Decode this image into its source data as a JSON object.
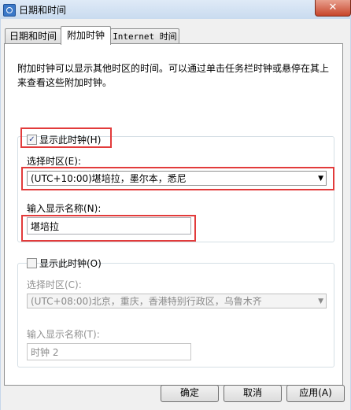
{
  "window": {
    "title": "日期和时间",
    "close_glyph": "✕"
  },
  "tabs": [
    {
      "label": "日期和时间"
    },
    {
      "label": "附加时钟"
    },
    {
      "label": "Internet 时间"
    }
  ],
  "description": "附加时钟可以显示其他时区的时间。可以通过单击任务栏时钟或悬停在其上来查看这些附加时钟。",
  "clock1": {
    "show_label": "显示此时钟(H)",
    "checked_glyph": "✓",
    "timezone_label": "选择时区(E):",
    "timezone_value": "(UTC+10:00)堪培拉，墨尔本，悉尼",
    "name_label": "输入显示名称(N):",
    "name_value": "堪培拉"
  },
  "clock2": {
    "show_label": "显示此时钟(O)",
    "timezone_label": "选择时区(C):",
    "timezone_value": "(UTC+08:00)北京，重庆，香港特别行政区，乌鲁木齐",
    "name_label": "输入显示名称(T):",
    "name_value": "时钟 2"
  },
  "buttons": {
    "ok": "确定",
    "cancel": "取消",
    "apply": "应用(A)"
  },
  "combo_arrow_glyph": "▼",
  "colors": {
    "highlight_red": "#e23b3b",
    "titlebar": "#c9dbef"
  }
}
